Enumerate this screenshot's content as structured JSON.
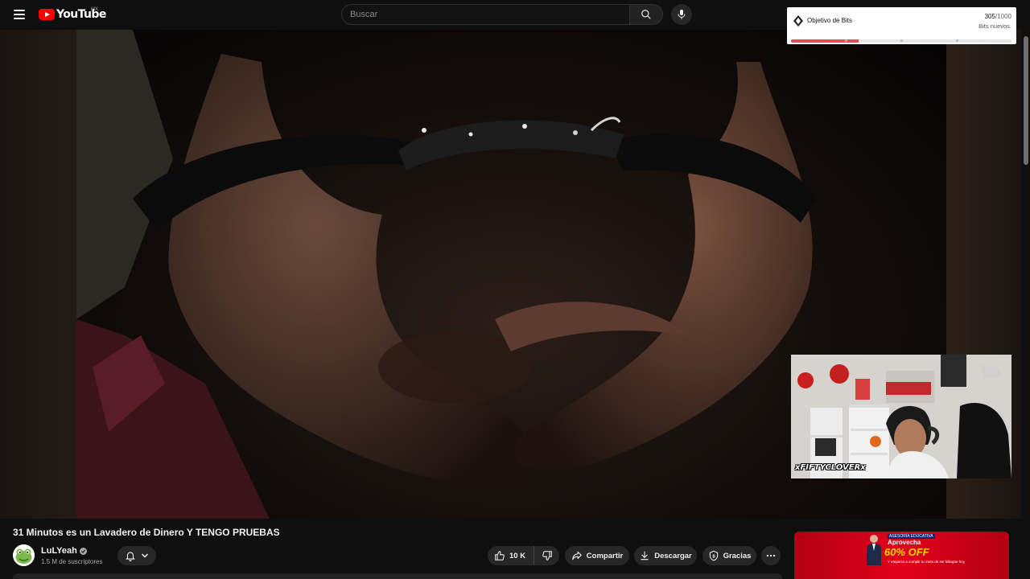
{
  "header": {
    "logo_text": "YouTube",
    "country_code": "MX",
    "search_placeholder": "Buscar"
  },
  "bits_widget": {
    "title": "Objetivo de Bits",
    "current": "305",
    "goal": "/1000",
    "subtitle": "Bits nuevos.",
    "progress": 0.305,
    "fill_color": "#e34f59"
  },
  "webcam": {
    "tag": "xFIFTYCLOVERx"
  },
  "video": {
    "title": "31 Minutos es un Lavadero de Dinero Y TENGO PRUEBAS"
  },
  "channel": {
    "name": "LuLYeah",
    "subscribers": "1.5 M de suscriptores"
  },
  "actions": {
    "likes": "10 K",
    "share": "Compartir",
    "download": "Descargar",
    "thanks": "Gracias"
  },
  "ad": {
    "tag": "ASESORÍA EDUCATIVA",
    "headline": "Aprovecha",
    "offer": "60% OFF",
    "footer": "Y empieza a cumplir tu meta de ser bilingüe hoy"
  }
}
